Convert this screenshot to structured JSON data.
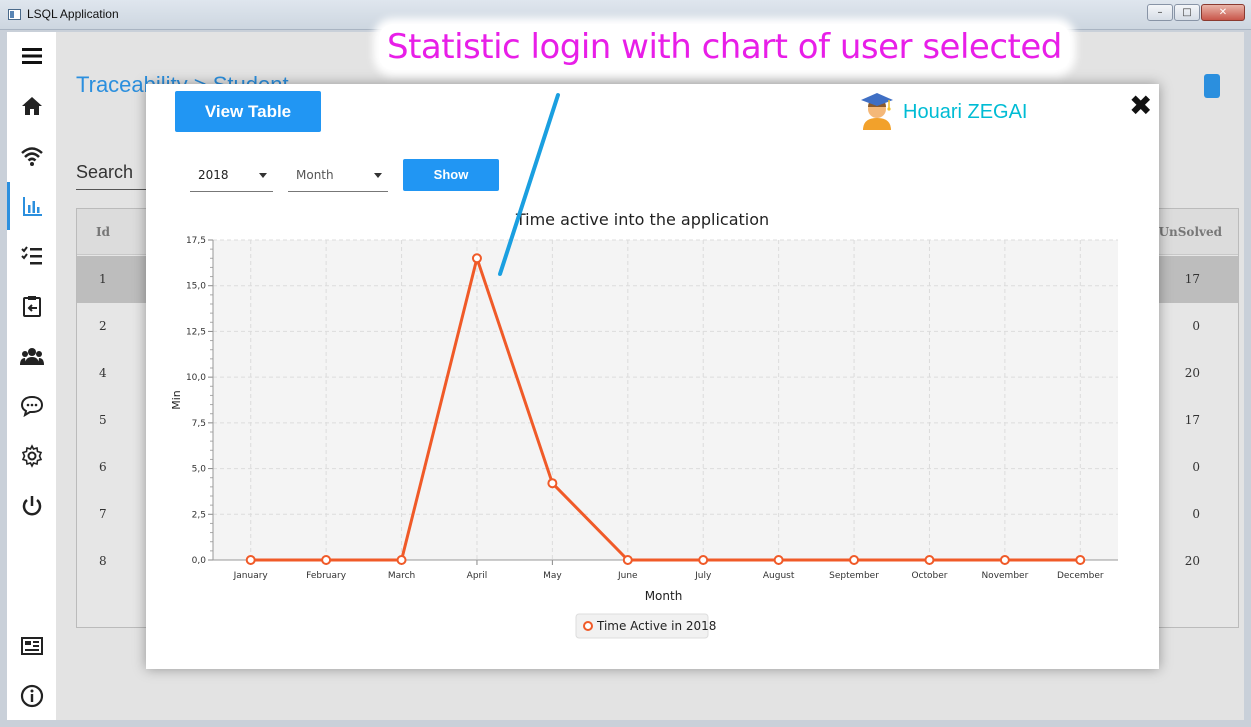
{
  "window": {
    "title": "LSQL Application",
    "min": "–",
    "max": "□",
    "close": "✕"
  },
  "sidebar": {
    "items": [
      {
        "icon": "menu-icon"
      },
      {
        "icon": "home-icon"
      },
      {
        "icon": "wifi-icon"
      },
      {
        "icon": "chart-icon",
        "active": true
      },
      {
        "icon": "checklist-icon"
      },
      {
        "icon": "clipboard-icon"
      },
      {
        "icon": "users-icon"
      },
      {
        "icon": "chat-icon"
      },
      {
        "icon": "gear-icon"
      },
      {
        "icon": "power-icon"
      },
      {
        "icon": "dashboard-icon"
      },
      {
        "icon": "info-icon"
      }
    ]
  },
  "background": {
    "breadcrumb": "Traceability > Student",
    "search_label": "Search",
    "table": {
      "col_id": "Id",
      "col_unsolved": "UnSolved",
      "rows": [
        {
          "id": "1",
          "unsolved": "17"
        },
        {
          "id": "2",
          "unsolved": "0"
        },
        {
          "id": "4",
          "unsolved": "20"
        },
        {
          "id": "5",
          "unsolved": "17"
        },
        {
          "id": "6",
          "unsolved": "0"
        },
        {
          "id": "7",
          "unsolved": "0"
        },
        {
          "id": "8",
          "unsolved": "20"
        }
      ]
    }
  },
  "modal": {
    "view_table_label": "View Table",
    "user_name": "Houari ZEGAI",
    "close_label": "✖",
    "year_value": "2018",
    "month_placeholder": "Month",
    "show_label": "Show"
  },
  "annotation": {
    "text": "Statistic login with chart of user selected",
    "color": "#e81ee8"
  },
  "colors": {
    "accent": "#2196f3",
    "series": "#f05a28",
    "user_name": "#00bcd4"
  },
  "chart_data": {
    "type": "line",
    "title": "Time active into the application",
    "xlabel": "Month",
    "ylabel": "Min",
    "categories": [
      "January",
      "February",
      "March",
      "April",
      "May",
      "June",
      "July",
      "August",
      "September",
      "October",
      "November",
      "December"
    ],
    "series": [
      {
        "name": "Time Active in 2018",
        "values": [
          0,
          0,
          0,
          16.5,
          4.2,
          0,
          0,
          0,
          0,
          0,
          0,
          0
        ]
      }
    ],
    "ylim": [
      0,
      17.5
    ],
    "yticks": [
      "0,0",
      "2,5",
      "5,0",
      "7,5",
      "10,0",
      "12,5",
      "15,0",
      "17,5"
    ],
    "grid": true,
    "legend": "bottom"
  }
}
